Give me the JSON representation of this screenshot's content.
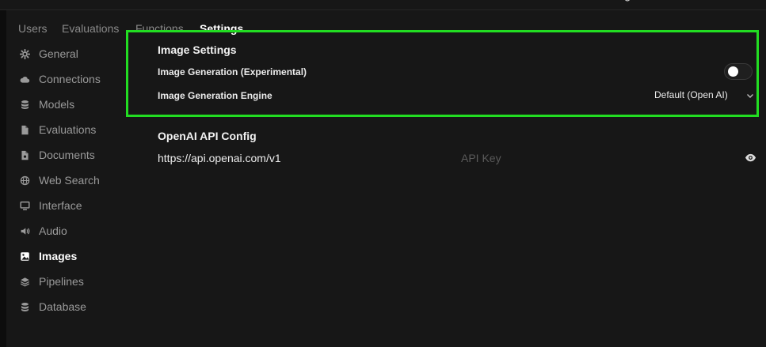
{
  "tabs": [
    {
      "label": "Users"
    },
    {
      "label": "Evaluations"
    },
    {
      "label": "Functions"
    },
    {
      "label": "Settings"
    }
  ],
  "sidebar": {
    "items": [
      {
        "label": "General",
        "icon": "gear-icon"
      },
      {
        "label": "Connections",
        "icon": "cloud-icon"
      },
      {
        "label": "Models",
        "icon": "database-icon"
      },
      {
        "label": "Evaluations",
        "icon": "document-icon"
      },
      {
        "label": "Documents",
        "icon": "document-icon"
      },
      {
        "label": "Web Search",
        "icon": "globe-icon"
      },
      {
        "label": "Interface",
        "icon": "monitor-icon"
      },
      {
        "label": "Audio",
        "icon": "speaker-icon"
      },
      {
        "label": "Images",
        "icon": "image-icon"
      },
      {
        "label": "Pipelines",
        "icon": "layers-icon"
      },
      {
        "label": "Database",
        "icon": "database-icon"
      }
    ],
    "active": "Images"
  },
  "image_settings": {
    "title": "Image Settings",
    "generation_label": "Image Generation (Experimental)",
    "generation_enabled": false,
    "engine_label": "Image Generation Engine",
    "engine_value": "Default (Open AI)"
  },
  "openai_config": {
    "title": "OpenAI API Config",
    "base_url": "https://api.openai.com/v1",
    "api_key_placeholder": "API Key"
  },
  "colors": {
    "highlight": "#22dd22",
    "background": "#171717"
  }
}
